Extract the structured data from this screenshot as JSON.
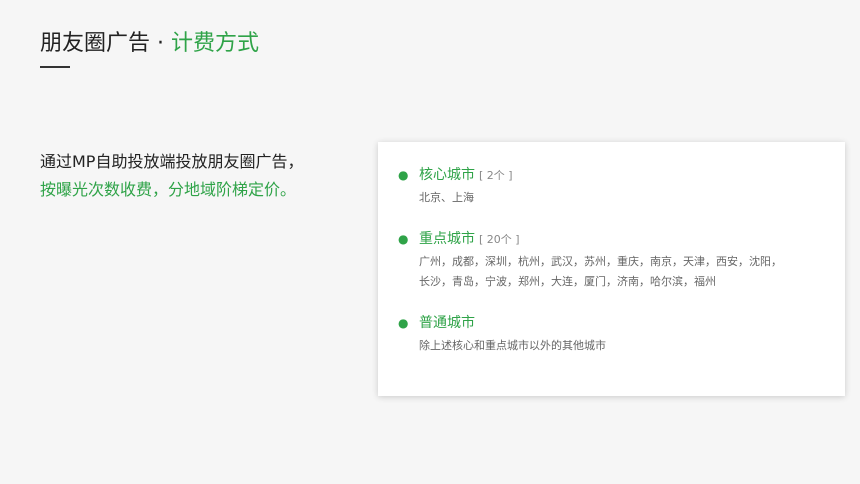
{
  "header": {
    "title": "朋友圈广告 · ",
    "title_accent": "计费方式"
  },
  "intro": {
    "line1": "通过MP自助投放端投放朋友圈广告，",
    "line2": "按曝光次数收费，分地域阶梯定价。"
  },
  "tiers": [
    {
      "name": "核心城市",
      "count": "[ 2个 ]",
      "lines": [
        "北京、上海"
      ]
    },
    {
      "name": "重点城市",
      "count": "[ 20个 ]",
      "lines": [
        "广州，成都，深圳，杭州，武汉，苏州，重庆，南京，天津，西安，沈阳，",
        "长沙，青岛，宁波，郑州，大连，厦门，济南，哈尔滨，福州"
      ]
    },
    {
      "name": "普通城市",
      "count": "",
      "lines": [
        "除上述核心和重点城市以外的其他城市"
      ]
    }
  ],
  "colors": {
    "accent": "#2fa348",
    "text": "#222222",
    "muted": "#666666",
    "background": "#f6f6f6"
  }
}
